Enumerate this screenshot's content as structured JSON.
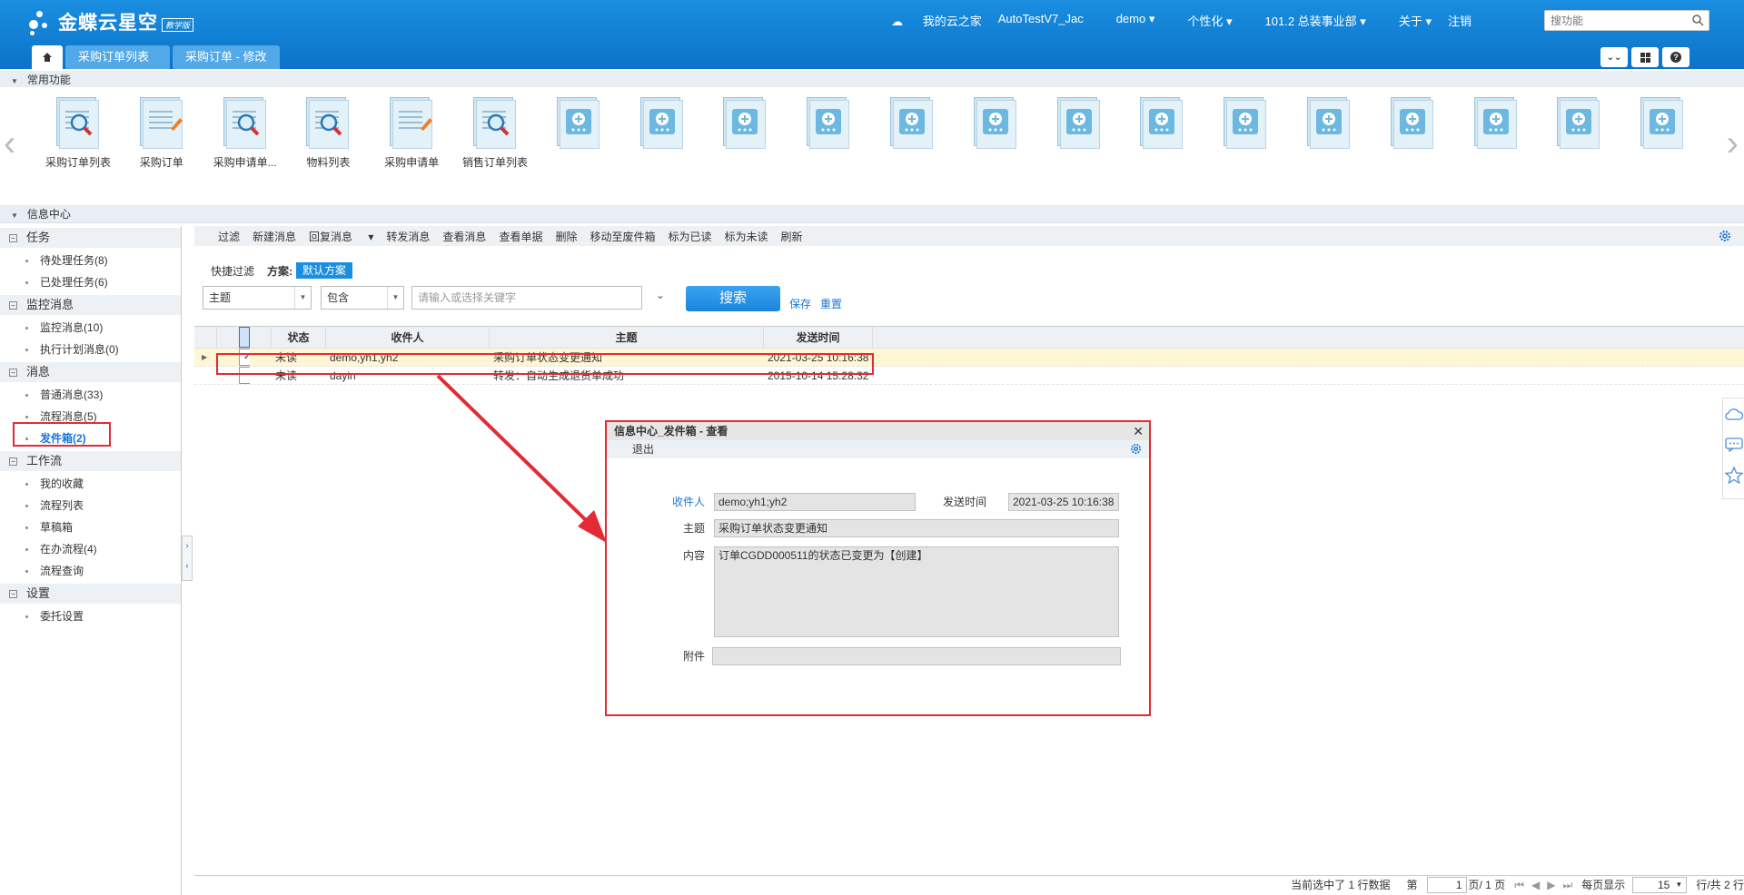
{
  "app": {
    "brand": "金蝶云星空",
    "edition": "教学版"
  },
  "topnav": {
    "cloud_home": "我的云之家",
    "tenant": "AutoTestV7_Jac",
    "user": "demo",
    "personalize": "个性化",
    "org": "101.2 总装事业部",
    "about": "关于",
    "logout": "注销",
    "search_placeholder": "搜功能"
  },
  "tabs": [
    {
      "label": "采购订单列表"
    },
    {
      "label": "采购订单 - 修改"
    }
  ],
  "common_functions": {
    "title": "常用功能",
    "items": [
      {
        "label": "采购订单列表"
      },
      {
        "label": "采购订单"
      },
      {
        "label": "采购申请单..."
      },
      {
        "label": "物料列表"
      },
      {
        "label": "采购申请单"
      },
      {
        "label": "销售订单列表"
      }
    ]
  },
  "info_center": {
    "title": "信息中心"
  },
  "nav": {
    "groups": [
      {
        "title": "任务",
        "items": [
          "待处理任务(8)",
          "已处理任务(6)"
        ]
      },
      {
        "title": "监控消息",
        "items": [
          "监控消息(10)",
          "执行计划消息(0)"
        ]
      },
      {
        "title": "消息",
        "items": [
          "普通消息(33)",
          "流程消息(5)",
          "发件箱(2)"
        ]
      },
      {
        "title": "工作流",
        "items": [
          "我的收藏",
          "流程列表",
          "草稿箱",
          "在办流程(4)",
          "流程查询"
        ]
      },
      {
        "title": "设置",
        "items": [
          "委托设置"
        ]
      }
    ]
  },
  "toolbar": {
    "items": [
      "过滤",
      "新建消息",
      "回复消息",
      "转发消息",
      "查看消息",
      "查看单据",
      "删除",
      "移动至废件箱",
      "标为已读",
      "标为未读",
      "刷新"
    ]
  },
  "filter": {
    "quick": "快捷过滤",
    "scheme_label": "方案:",
    "scheme": "默认方案",
    "field": "主题",
    "op": "包含",
    "keyword_placeholder": "请输入或选择关键字",
    "search": "搜索",
    "save": "保存",
    "reset": "重置"
  },
  "grid": {
    "headers": [
      "状态",
      "收件人",
      "主题",
      "发送时间"
    ],
    "rows": [
      {
        "status": "未读",
        "to": "demo,yh1,yh2",
        "subject": "采购订单状态变更通知",
        "time": "2021-03-25 10:16:38",
        "checked": true
      },
      {
        "status": "未读",
        "to": "dayin",
        "subject": "转发：自动生成退货单成功",
        "time": "2015-10-14 15:28:32",
        "checked": false
      }
    ]
  },
  "dialog": {
    "title": "信息中心_发件箱 - 查看",
    "exit": "退出",
    "to_label": "收件人",
    "to": "demo;yh1;yh2",
    "time_label": "发送时间",
    "time": "2021-03-25 10:16:38",
    "subject_label": "主题",
    "subject": "采购订单状态变更通知",
    "content_label": "内容",
    "content": "订单CGDD000511的状态已变更为【创建】",
    "attach_label": "附件"
  },
  "status": {
    "selected": "当前选中了 1 行数据",
    "page_pre": "第",
    "page": "1",
    "page_post": "页/ 1 页",
    "per_page_label": "每页显示",
    "per_page": "15",
    "total": "行/共 2 行"
  },
  "colors": {
    "accent": "#1a8ee0",
    "highlight": "#e32b33"
  }
}
